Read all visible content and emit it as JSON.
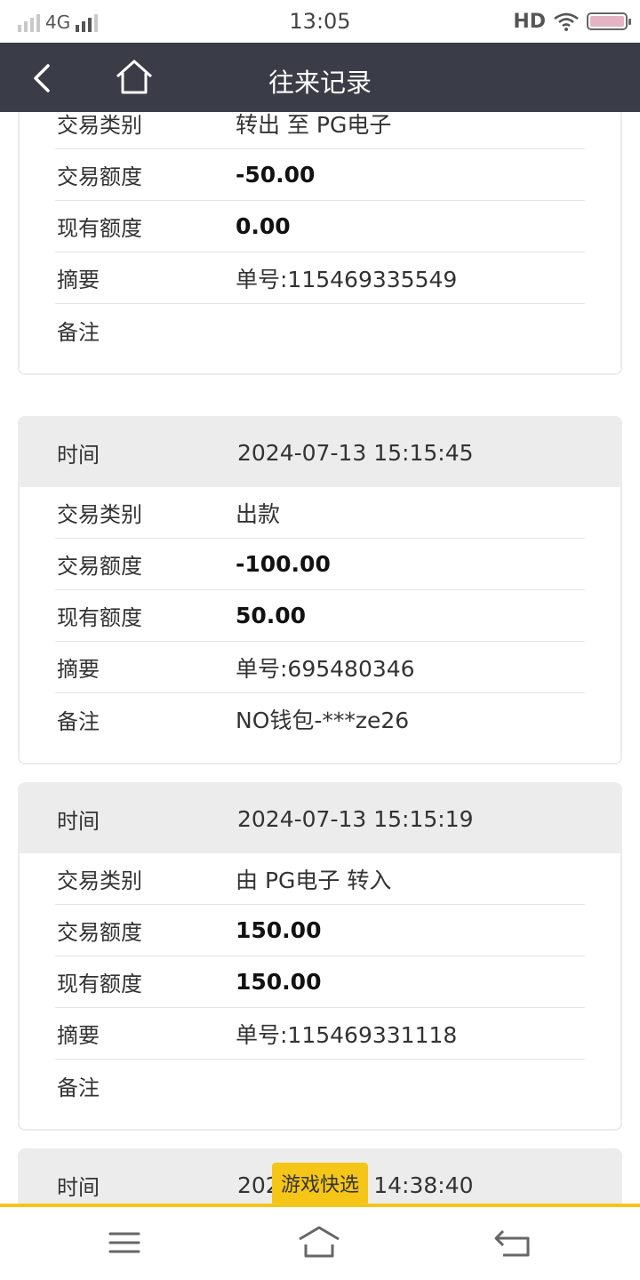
{
  "status_bar": {
    "network": "4G",
    "time": "13:05",
    "hd": "HD"
  },
  "header": {
    "title": "往来记录",
    "back_icon": "chevron-left-icon",
    "home_icon": "home-icon"
  },
  "records": [
    {
      "time_label": "",
      "time": "",
      "rows": [
        {
          "label": "交易类别",
          "value": "转出 至 PG电子"
        },
        {
          "label": "交易额度",
          "value": "-50.00"
        },
        {
          "label": "现有额度",
          "value": "0.00"
        },
        {
          "label": "摘要",
          "value": "单号:115469335549"
        },
        {
          "label": "备注",
          "value": ""
        }
      ]
    },
    {
      "time_label": "时间",
      "time": "2024-07-13 15:15:45",
      "rows": [
        {
          "label": "交易类别",
          "value": "出款"
        },
        {
          "label": "交易额度",
          "value": "-100.00"
        },
        {
          "label": "现有额度",
          "value": "50.00"
        },
        {
          "label": "摘要",
          "value": "单号:695480346"
        },
        {
          "label": "备注",
          "value": "NO钱包-***ze26"
        }
      ]
    },
    {
      "time_label": "时间",
      "time": "2024-07-13 15:15:19",
      "rows": [
        {
          "label": "交易类别",
          "value": "由 PG电子 转入"
        },
        {
          "label": "交易额度",
          "value": "150.00"
        },
        {
          "label": "现有额度",
          "value": "150.00"
        },
        {
          "label": "摘要",
          "value": "单号:115469331118"
        },
        {
          "label": "备注",
          "value": ""
        }
      ]
    },
    {
      "time_label": "时间",
      "time": "2024-07-13 14:38:40",
      "rows": []
    }
  ],
  "float_badge": "游戏快选",
  "nav": {
    "menu_icon": "menu-icon",
    "home_icon": "home-icon",
    "back_icon": "back-icon"
  },
  "colors": {
    "header_bg": "#3a3d47",
    "accent": "#f5c518",
    "card_head_bg": "#ececec"
  }
}
